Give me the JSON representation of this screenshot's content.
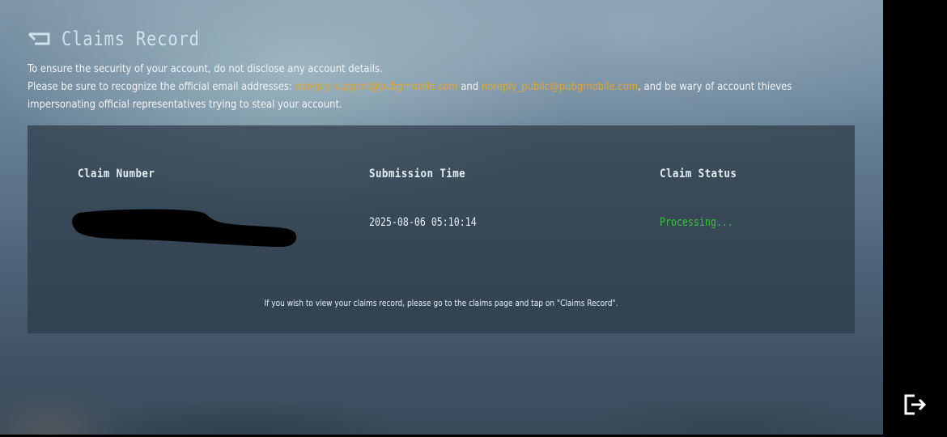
{
  "header": {
    "title": "Claims Record",
    "back_icon": "back-arrow-icon"
  },
  "notice": {
    "line1": "To ensure the security of your account, do not disclose any account details.",
    "line2_prefix": "Please be sure to recognize the official email addresses: ",
    "email1": "noreply-support@pubgmobile.com",
    "and": " and ",
    "email2": "noreply_public@pubgmobile.com",
    "line2_suffix": ", and be wary of account thieves impersonating official representatives trying to steal your account."
  },
  "table": {
    "headers": [
      "Claim Number",
      "Submission Time",
      "Claim Status"
    ],
    "rows": [
      {
        "claim_number": "",
        "submission_time": "2025-08-06 05:10:14",
        "status": "Processing..."
      }
    ]
  },
  "footer_note": "If you wish to view your claims record, please go to the claims page and tap on \"Claims Record\".",
  "exit_icon": "exit-icon",
  "colors": {
    "accent_email": "#e0a832",
    "status_processing": "#35c23d",
    "text": "#e4eef2"
  }
}
